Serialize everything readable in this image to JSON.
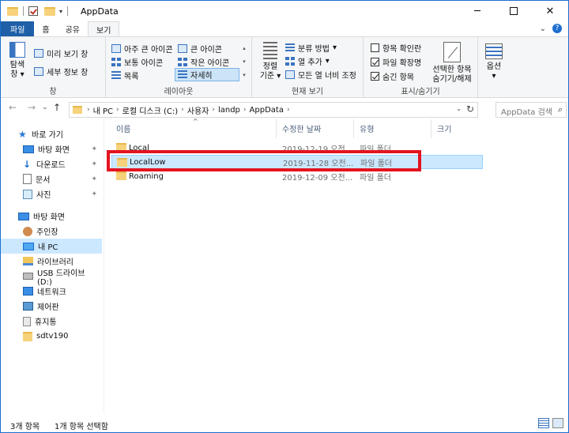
{
  "window": {
    "title": "AppData",
    "controls": {
      "minimize": "─",
      "close": "✕"
    }
  },
  "quick_access": {
    "dropdown": "▾"
  },
  "ribbon_tabs": {
    "file": "파일",
    "home": "홈",
    "share": "공유",
    "view": "보기",
    "expand": "⌄"
  },
  "ribbon": {
    "pane": {
      "nav_pane_line1": "탐색",
      "nav_pane_line2": "창",
      "preview_pane": "미리 보기 창",
      "details_pane": "세부 정보 창",
      "group_label": "창"
    },
    "layout": {
      "extra_large": "아주 큰 아이콘",
      "large": "큰 아이콘",
      "medium": "보통 아이콘",
      "small": "작은 아이콘",
      "list": "목록",
      "details": "자세히",
      "group_label": "레이아웃"
    },
    "current_view": {
      "sort_line1": "정렬",
      "sort_line2": "기준",
      "group_by": "분류 방법",
      "add_columns": "열 추가",
      "size_all_columns": "모든 열 너비 조정",
      "group_label": "현재 보기"
    },
    "show_hide": {
      "item_checkboxes": {
        "label": "항목 확인란",
        "checked": false
      },
      "file_extensions": {
        "label": "파일 확장명",
        "checked": true
      },
      "hidden_items": {
        "label": "숨긴 항목",
        "checked": true
      },
      "hide_selected_line1": "선택한 항목",
      "hide_selected_line2": "숨기기/해제",
      "group_label": "표시/숨기기"
    },
    "options": {
      "label": "옵션"
    }
  },
  "address_bar": {
    "back": "←",
    "forward": "→",
    "recent": "⌄",
    "up": "↑",
    "crumbs": [
      "내 PC",
      "로컬 디스크 (C:)",
      "사용자",
      "landp",
      "AppData"
    ],
    "dropdown": "⌄",
    "refresh": "↻",
    "search_placeholder": "AppData 검색",
    "search_icon": "⌕"
  },
  "nav_pane": {
    "quick_access": "바로 가기",
    "desktop_pinned": "바탕 화면",
    "downloads": "다운로드",
    "documents": "문서",
    "pictures": "사진",
    "desktop": "바탕 화면",
    "user": "주인장",
    "this_pc": "내 PC",
    "libraries": "라이브러리",
    "usb": "USB 드라이브 (D:)",
    "network": "네트워크",
    "control_panel": "제어판",
    "recycle_bin": "휴지통",
    "folder": "sdtv190",
    "pin_icon": "📌"
  },
  "file_list": {
    "columns": {
      "name": "이름",
      "date": "수정한 날짜",
      "type": "유형",
      "size": "크기"
    },
    "sort_arrow": "^",
    "rows": [
      {
        "name": "Local",
        "date": "2019-12-19 오전...",
        "type": "파일 폴더"
      },
      {
        "name": "LocalLow",
        "date": "2019-11-28 오전...",
        "type": "파일 폴더"
      },
      {
        "name": "Roaming",
        "date": "2019-12-09 오전...",
        "type": "파일 폴더"
      }
    ]
  },
  "status_bar": {
    "item_count": "3개 항목",
    "selected_count": "1개 항목 선택함"
  },
  "colors": {
    "file_tab": "#1e5fa8",
    "selection": "#cce8ff",
    "highlight_border": "#e3141f",
    "folder": "#f6d27a"
  }
}
